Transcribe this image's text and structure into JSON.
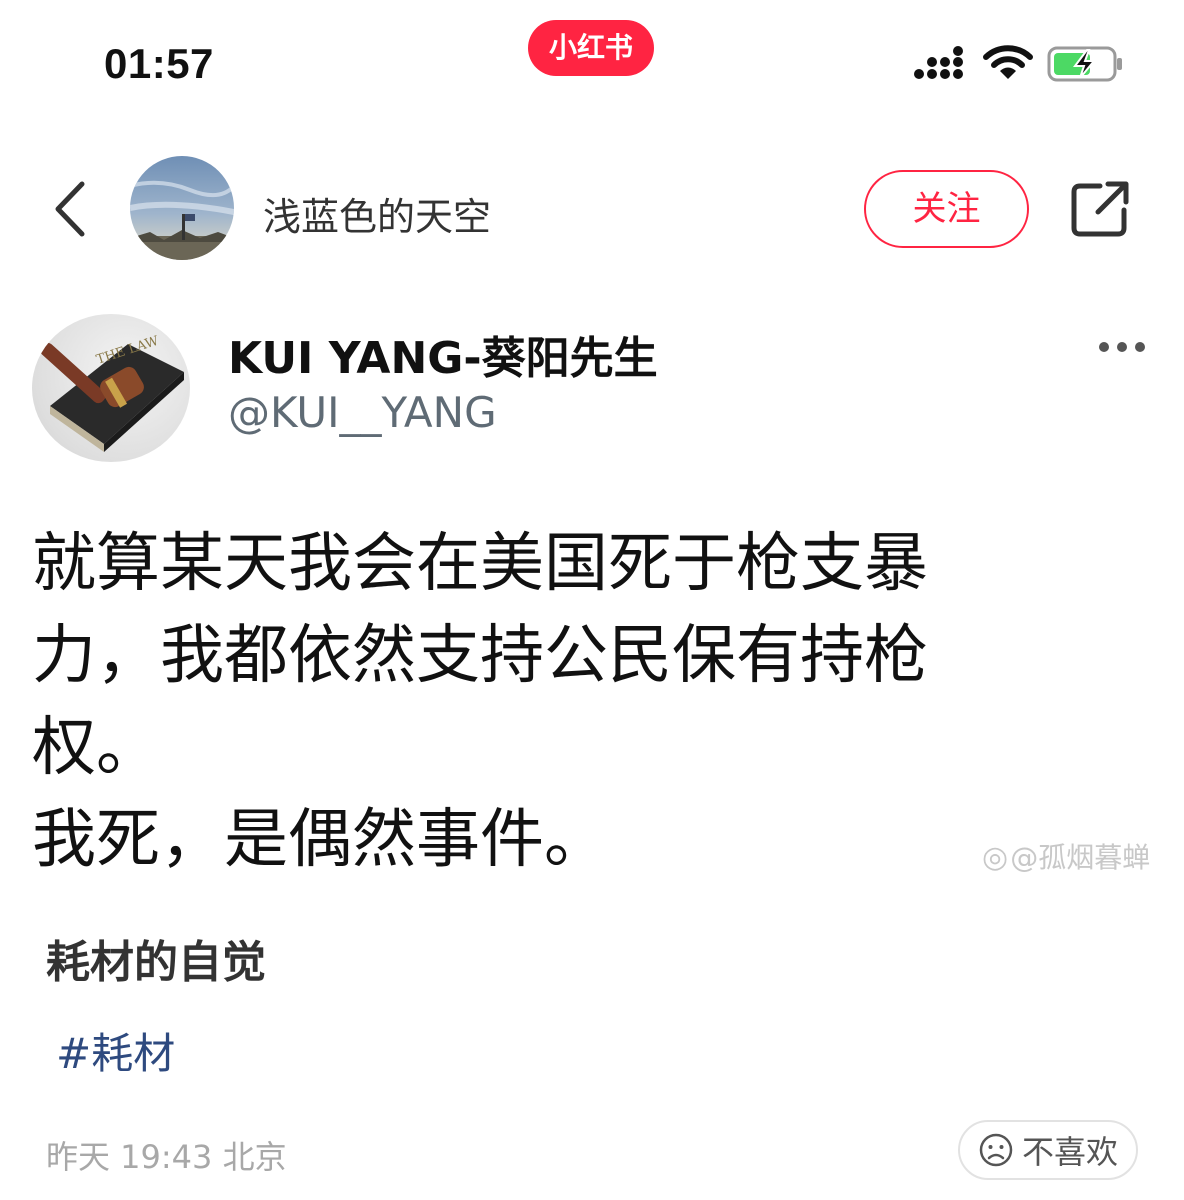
{
  "status_bar": {
    "time": "01:57",
    "app_badge": "小红书"
  },
  "header": {
    "author_name": "浅蓝色的天空",
    "follow_label": "关注"
  },
  "tweet": {
    "avatar_text": "THE LAW",
    "display_name": "KUI YANG-葵阳先生",
    "handle": "@KUI__YANG",
    "lines": [
      "就算某天我会在美国死于枪支暴",
      "力，我都依然支持公民保有持枪",
      "权。",
      "我死，是偶然事件。"
    ],
    "watermark": "@孤烟暮蝉"
  },
  "note": {
    "title": "耗材的自觉",
    "hashtag": "#耗材"
  },
  "footer": {
    "meta": "昨天 19:43 北京",
    "dislike_label": "不喜欢"
  },
  "colors": {
    "brand_red": "#ff2442",
    "hashtag_blue": "#2e4a7f",
    "meta_gray": "#a8a8a8"
  },
  "icons": [
    "signal-icon",
    "wifi-icon",
    "battery-charging-icon",
    "back-chevron-icon",
    "share-icon",
    "more-icon",
    "sad-face-icon",
    "weibo-icon"
  ]
}
